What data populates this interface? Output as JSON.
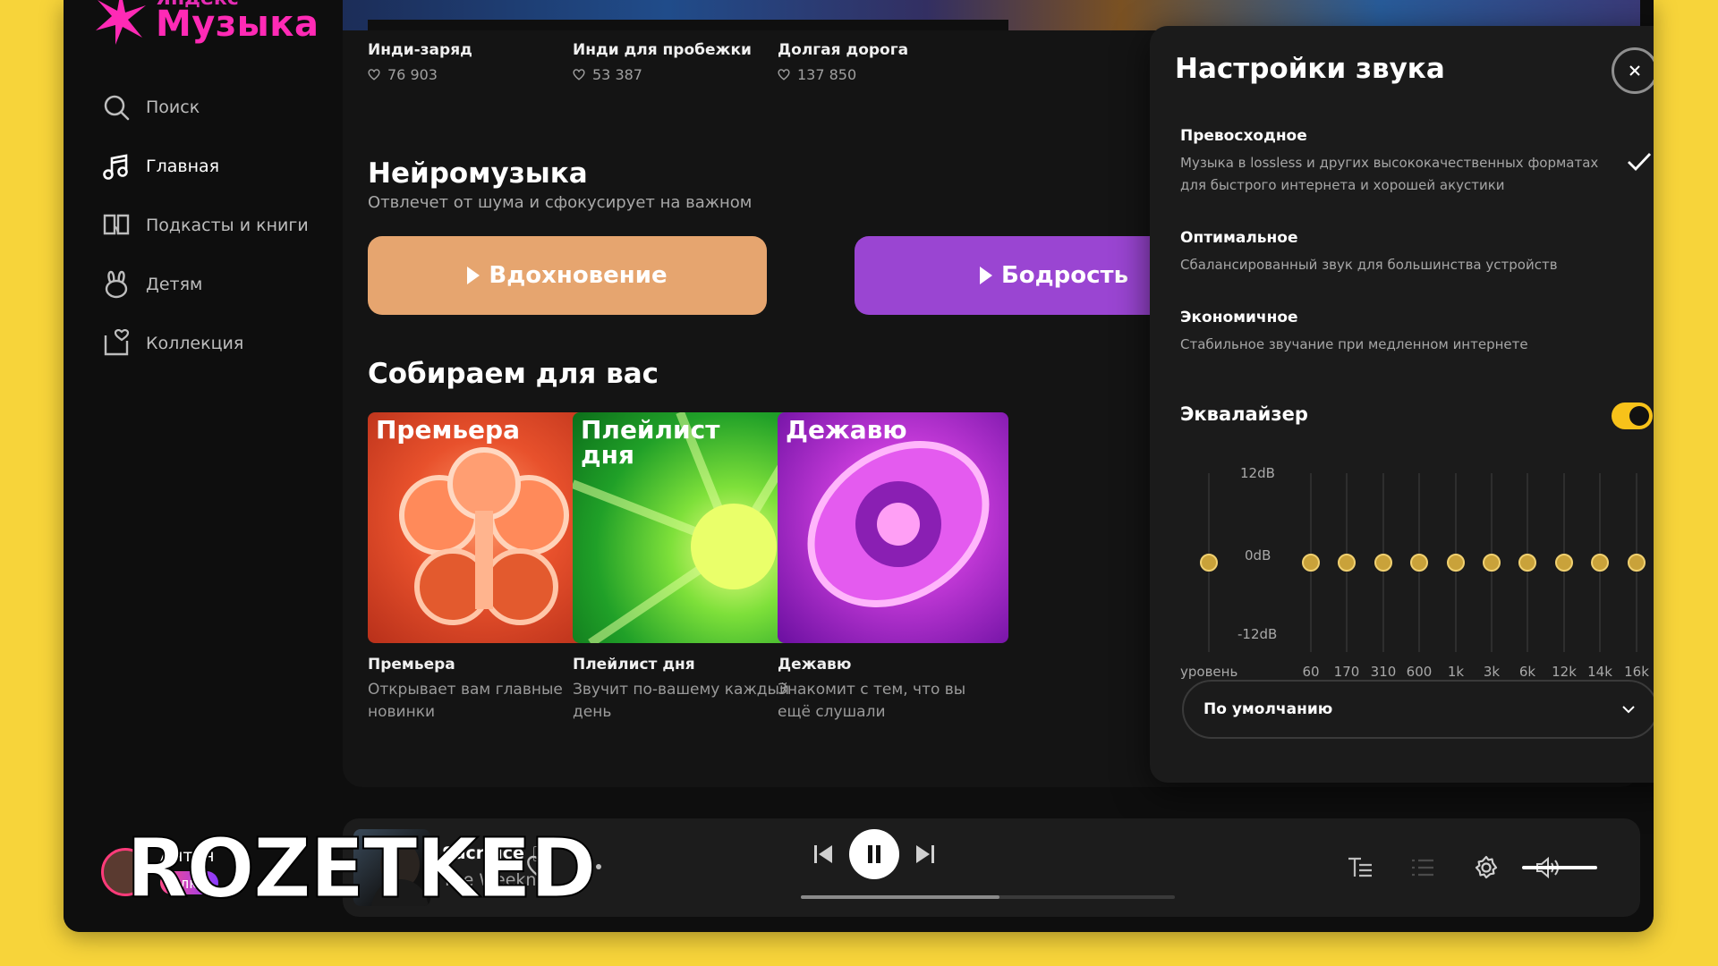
{
  "logo": {
    "small": "Яндекс",
    "big": "Музыка"
  },
  "nav": [
    {
      "label": "Поиск"
    },
    {
      "label": "Главная"
    },
    {
      "label": "Подкасты и книги"
    },
    {
      "label": "Детям"
    },
    {
      "label": "Коллекция"
    }
  ],
  "top_playlists": [
    {
      "name": "Инди-заряд",
      "likes": "76 903"
    },
    {
      "name": "Инди для пробежки",
      "likes": "53 387"
    },
    {
      "name": "Долгая дорога",
      "likes": "137 850"
    }
  ],
  "neuro": {
    "title": "Нейромузыка",
    "subtitle": "Отвлечет от шума и сфокусирует на важном",
    "buttons": [
      {
        "label": "Вдохновение",
        "color": "#e6a56f"
      },
      {
        "label": "Бодрость",
        "color": "#9a45d2"
      }
    ]
  },
  "collect": {
    "title": "Собираем для вас",
    "cards": [
      {
        "cover_title": "Премьера",
        "name": "Премьера",
        "desc": "Открывает вам главные новинки"
      },
      {
        "cover_title": "Плейлист дня",
        "name": "Плейлист дня",
        "desc": "Звучит по-вашему каждый день"
      },
      {
        "cover_title": "Дежавю",
        "name": "Дежавю",
        "desc": "Знакомит с тем, что вы ещё слушали"
      }
    ]
  },
  "sound": {
    "title": "Настройки звука",
    "qualities": [
      {
        "name": "Превосходное",
        "desc": "Музыка в lossless и других высококачественных форматах для быстрого интернета и хорошей акустики",
        "selected": true
      },
      {
        "name": "Оптимальное",
        "desc": "Сбалансированный звук для большинства устройств",
        "selected": false
      },
      {
        "name": "Экономичное",
        "desc": "Стабильное звучание при медленном интернете",
        "selected": false
      }
    ],
    "eq_label": "Эквалайзер",
    "eq_enabled": true,
    "db_labels": {
      "top": "12dB",
      "mid": "0dB",
      "bottom": "-12dB"
    },
    "level_label": "уровень",
    "bands": [
      "60",
      "170",
      "310",
      "600",
      "1k",
      "3k",
      "6k",
      "12k",
      "14k",
      "16k"
    ],
    "band_gains_db": [
      0,
      0,
      0,
      0,
      0,
      0,
      0,
      0,
      0,
      0
    ],
    "preamp_db": 0,
    "preset": "По умолчанию"
  },
  "player": {
    "title": "Sacrifice",
    "explicit": "E",
    "artist": "The Weeknd",
    "progress": 0.53,
    "volume": 1.0
  },
  "account": {
    "name": "Антон",
    "plus": "Плюс"
  },
  "watermark": "ROZETKED",
  "colors": {
    "accent": "#f7c21a",
    "background": "#f7d43a",
    "brand": "#ff2ab5"
  }
}
